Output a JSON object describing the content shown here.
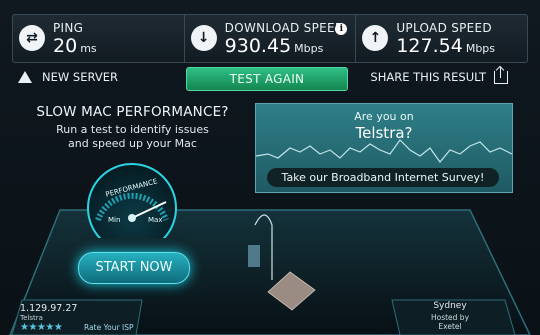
{
  "stats": {
    "ping": {
      "label": "PING",
      "value": "20",
      "unit": "ms"
    },
    "download": {
      "label": "DOWNLOAD SPEED",
      "value": "930.45",
      "unit": "Mbps"
    },
    "upload": {
      "label": "UPLOAD SPEED",
      "value": "127.54",
      "unit": "Mbps"
    }
  },
  "actions": {
    "new_server": "NEW SERVER",
    "test_again": "TEST AGAIN",
    "share": "SHARE THIS RESULT"
  },
  "promo": {
    "title": "SLOW MAC PERFORMANCE?",
    "subtitle_line1": "Run a test to identify issues",
    "subtitle_line2": "and speed up your Mac"
  },
  "ad": {
    "line1": "Are you on",
    "line2": "Telstra?",
    "survey": "Take our Broadband Internet Survey!"
  },
  "gauge": {
    "label": "PERFORMANCE",
    "min": "Min",
    "max": "Max",
    "start_button": "START NOW"
  },
  "footer": {
    "ip": "1.129.97.27",
    "isp": "Telstra",
    "stars": "★★★★★",
    "rate": "Rate Your ISP",
    "server_city": "Sydney",
    "hosted_by": "Hosted by",
    "host": "Exetel"
  },
  "colors": {
    "accent_green": "#2fbf86",
    "accent_teal": "#27b0bf",
    "ad_panel": "#2f7f88"
  }
}
